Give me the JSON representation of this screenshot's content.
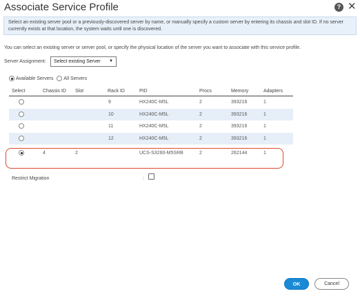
{
  "dialog": {
    "title": "Associate Service Profile",
    "help_glyph": "?",
    "close_glyph": "✕"
  },
  "info_text": "Select an existing server pool or a previously-discovered server by name, or manually specify a custom server by entering its chassis and slot ID. If no server currently exists at that location, the system waits until one is discovered.",
  "instruction_text": "You can select an existing server or server pool, or specify the physical location of the server you want to associate with this service profile.",
  "server_assignment": {
    "label": "Server Assignment:",
    "value": "Select existing Server",
    "caret": "▼"
  },
  "filter": {
    "options": [
      {
        "label": "Available Servers",
        "selected": true
      },
      {
        "label": "All Servers",
        "selected": false
      }
    ]
  },
  "table": {
    "columns": [
      "Select",
      "Chassis ID",
      "Slot",
      "Rack ID",
      "PID",
      "Procs",
      "Memory",
      "Adapters"
    ],
    "rows": [
      {
        "selected": false,
        "chassis": "",
        "slot": "",
        "rack": "9",
        "pid": "HX240C-M5L",
        "procs": "2",
        "memory": "393216",
        "adapters": "1"
      },
      {
        "selected": false,
        "chassis": "",
        "slot": "",
        "rack": "10",
        "pid": "HX240C-M5L",
        "procs": "2",
        "memory": "393216",
        "adapters": "1"
      },
      {
        "selected": false,
        "chassis": "",
        "slot": "",
        "rack": "11",
        "pid": "HX240C-M5L",
        "procs": "2",
        "memory": "393216",
        "adapters": "1"
      },
      {
        "selected": false,
        "chassis": "",
        "slot": "",
        "rack": "12",
        "pid": "HX240C-M5L",
        "procs": "2",
        "memory": "393216",
        "adapters": "1"
      },
      {
        "selected": true,
        "chassis": "4",
        "slot": "2",
        "rack": "",
        "pid": "UCS-S3260-M5SRB",
        "procs": "2",
        "memory": "262144",
        "adapters": "1"
      }
    ]
  },
  "restrict_migration": {
    "label": "Restrict Migration",
    "colon": ":",
    "checked": false
  },
  "buttons": {
    "ok": "OK",
    "cancel": "Cancel"
  },
  "colors": {
    "accent": "#1a8ad6",
    "highlight": "#d9462e",
    "row_stripe": "#e6eff8"
  }
}
